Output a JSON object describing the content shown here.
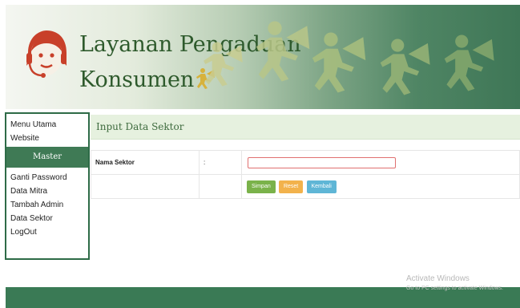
{
  "header": {
    "title_line1": "Layanan Pengaduan",
    "title_line2": "Konsumen",
    "logo_icon": "operator-headset-icon",
    "runner_icon": "running-person-megaphone-icon"
  },
  "sidebar": {
    "items_top": [
      "Menu Utama",
      "Website"
    ],
    "master_label": "Master",
    "items_bottom": [
      "Ganti Password",
      "Data Mitra",
      "Tambah Admin",
      "Data Sektor",
      "LogOut"
    ]
  },
  "content": {
    "title": "Input Data Sektor",
    "form": {
      "field_label": "Nama Sektor",
      "separator": ":",
      "field_value": "",
      "field_placeholder": ""
    },
    "buttons": {
      "save": "Simpan",
      "reset": "Reset",
      "back": "Kembali"
    }
  },
  "watermark": {
    "line1": "Activate Windows",
    "line2": "Go to PC settings to activate Windows."
  },
  "colors": {
    "primary_green": "#3f7a55",
    "header_bg": "#e6f1df",
    "save": "#7ab24a",
    "reset": "#f2b24c",
    "back": "#5fb6d6"
  }
}
